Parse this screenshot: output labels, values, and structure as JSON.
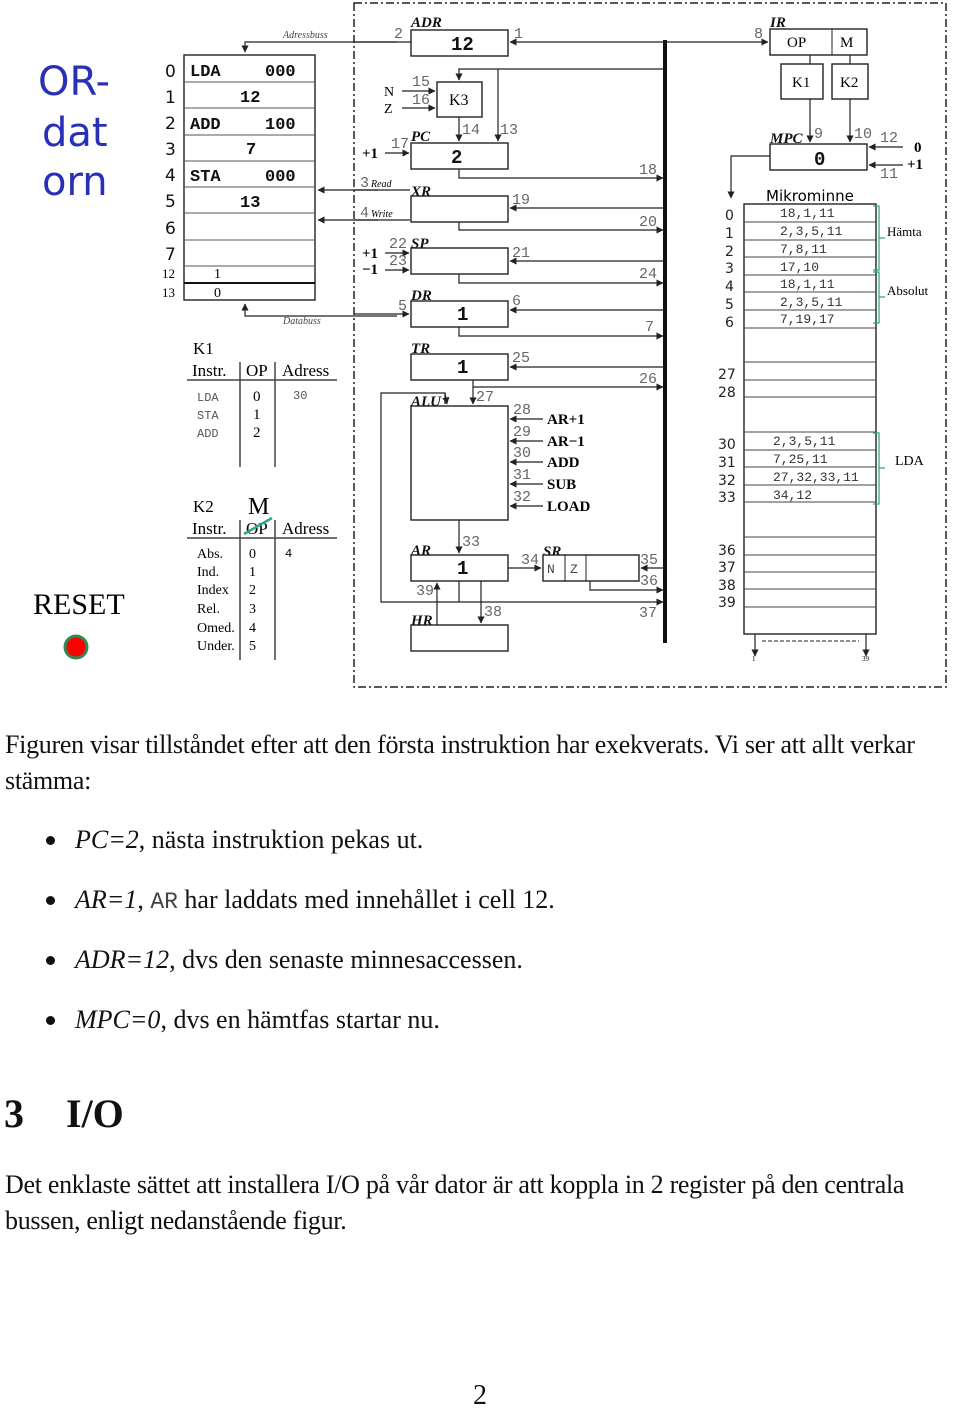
{
  "figure": {
    "title_lines": [
      "OR-",
      "dat",
      "orn"
    ],
    "title_color": "#2a2fb8",
    "reset_label": "RESET",
    "reset_button_color": "#ff0000",
    "reset_button_ring_color": "#2e8b57",
    "memory": {
      "addressbus_label": "Adressbuss",
      "databus_label": "Databuss",
      "rows": [
        {
          "addr": "0",
          "op": "LDA",
          "arg": "000",
          "value": ""
        },
        {
          "addr": "1",
          "op": "",
          "arg": "",
          "value": "12"
        },
        {
          "addr": "2",
          "op": "ADD",
          "arg": "100",
          "value": ""
        },
        {
          "addr": "3",
          "op": "",
          "arg": "",
          "value": "7"
        },
        {
          "addr": "4",
          "op": "STA",
          "arg": "000",
          "value": ""
        },
        {
          "addr": "5",
          "op": "",
          "arg": "",
          "value": "13"
        },
        {
          "addr": "6",
          "op": "",
          "arg": "",
          "value": ""
        },
        {
          "addr": "7",
          "op": "",
          "arg": "",
          "value": ""
        },
        {
          "addr": "12",
          "op": "",
          "arg": "",
          "value": "1"
        },
        {
          "addr": "13",
          "op": "",
          "arg": "",
          "value": "0"
        }
      ]
    },
    "k1_table": {
      "title": "K1",
      "headers": [
        "Instr.",
        "OP",
        "Adress"
      ],
      "rows": [
        {
          "instr": "LDA",
          "op": "0",
          "adress": "30"
        },
        {
          "instr": "STA",
          "op": "1",
          "adress": ""
        },
        {
          "instr": "ADD",
          "op": "2",
          "adress": ""
        }
      ]
    },
    "k2_table": {
      "title": "K2",
      "overwrite_label": "M",
      "headers": [
        "Instr.",
        "OP",
        "Adress"
      ],
      "rows": [
        {
          "instr": "Abs.",
          "op": "0",
          "adress": "4"
        },
        {
          "instr": "Ind.",
          "op": "1",
          "adress": ""
        },
        {
          "instr": "Index",
          "op": "2",
          "adress": ""
        },
        {
          "instr": "Rel.",
          "op": "3",
          "adress": ""
        },
        {
          "instr": "Omed.",
          "op": "4",
          "adress": ""
        },
        {
          "instr": "Under.",
          "op": "5",
          "adress": ""
        }
      ]
    },
    "registers": {
      "adr": {
        "label": "ADR",
        "value": "12",
        "in_signal": "1",
        "out_signal": "2"
      },
      "k3": {
        "label": "K3",
        "n_label": "N",
        "z_label": "Z",
        "n_signal": "15",
        "z_signal": "16",
        "out_signal": "14",
        "bypass_signal": "13"
      },
      "pc": {
        "label": "PC",
        "value": "2",
        "inc_label": "+1",
        "inc_signal": "17",
        "out_signal": "18"
      },
      "read": {
        "signal": "3",
        "label": "Read"
      },
      "write": {
        "signal": "4",
        "label": "Write"
      },
      "xr": {
        "label": "XR",
        "value": "",
        "in_signal": "19",
        "out_signal": "20"
      },
      "sp": {
        "label": "SP",
        "value": "",
        "inc_label": "+1",
        "dec_label": "−1",
        "inc_signal": "22",
        "dec_signal": "23",
        "in_signal": "21",
        "out_signal": "24"
      },
      "dr": {
        "label": "DR",
        "value": "1",
        "mem_signal": "5",
        "in_signal": "6",
        "out_signal": "7"
      },
      "tr": {
        "label": "TR",
        "value": "1",
        "in_signal": "25",
        "out_signal": "26"
      },
      "alu": {
        "label": "ALU",
        "in_signal": "27",
        "ops": [
          {
            "signal": "28",
            "label": "AR+1"
          },
          {
            "signal": "29",
            "label": "AR−1"
          },
          {
            "signal": "30",
            "label": "ADD"
          },
          {
            "signal": "31",
            "label": "SUB"
          },
          {
            "signal": "32",
            "label": "LOAD"
          }
        ]
      },
      "ar": {
        "label": "AR",
        "value": "1",
        "in_signal": "33",
        "hr_in_signal": "39",
        "out_signal": "37"
      },
      "sr": {
        "label": "SR",
        "flags": [
          "N",
          "Z"
        ],
        "in_signal": "34",
        "bus_in_signal": "35",
        "out_signal": "36"
      },
      "hr": {
        "label": "HR",
        "value": "",
        "in_signal": "38"
      },
      "ir": {
        "label": "IR",
        "fields": [
          "OP",
          "M"
        ],
        "in_signal": "8"
      },
      "k1": {
        "label": "K1",
        "signal": "9"
      },
      "k2": {
        "label": "K2",
        "signal": "10"
      },
      "mpc": {
        "label": "MPC",
        "value": "0",
        "reset_label": "0",
        "reset_signal": "12",
        "inc_label": "+1",
        "inc_signal": "11"
      }
    },
    "microprogram": {
      "title": "Mikrominne",
      "rows": [
        {
          "addr": "0",
          "signals": "18,1,11"
        },
        {
          "addr": "1",
          "signals": "2,3,5,11"
        },
        {
          "addr": "2",
          "signals": "7,8,11"
        },
        {
          "addr": "3",
          "signals": "17,10"
        },
        {
          "addr": "4",
          "signals": "18,1,11"
        },
        {
          "addr": "5",
          "signals": "2,3,5,11"
        },
        {
          "addr": "6",
          "signals": "7,19,17"
        },
        {
          "addr": "27",
          "signals": ""
        },
        {
          "addr": "28",
          "signals": ""
        },
        {
          "addr": "30",
          "signals": "2,3,5,11"
        },
        {
          "addr": "31",
          "signals": "7,25,11"
        },
        {
          "addr": "32",
          "signals": "27,32,33,11"
        },
        {
          "addr": "33",
          "signals": "34,12"
        },
        {
          "addr": "36",
          "signals": ""
        },
        {
          "addr": "37",
          "signals": ""
        },
        {
          "addr": "38",
          "signals": ""
        },
        {
          "addr": "39",
          "signals": ""
        }
      ],
      "groups": [
        {
          "label": "Hämta"
        },
        {
          "label": "Absolut"
        },
        {
          "label": "LDA"
        }
      ],
      "output_first": "1",
      "output_last": "39",
      "brace_color": "#2fa88a"
    }
  },
  "text": {
    "para1": "Figuren visar tillståndet efter att den första instruktion har exekverats. Vi ser att allt verkar stämma:",
    "bullets": [
      {
        "lead": "PC=2",
        "rest": ", nästa instruktion pekas ut.",
        "code": "",
        "tail": ""
      },
      {
        "lead": "AR=1",
        "rest": ", ",
        "code": "AR",
        "tail": " har laddats med innehållet i cell 12."
      },
      {
        "lead": "ADR=12",
        "rest": ", dvs den senaste minnesaccessen.",
        "code": "",
        "tail": ""
      },
      {
        "lead": "MPC=0",
        "rest": ", dvs en hämtfas startar nu.",
        "code": "",
        "tail": ""
      }
    ],
    "section_number": "3",
    "section_title": "I/O",
    "para2": "Det enklaste sättet att installera I/O på vår dator är att koppla in 2 register på den centrala bussen, enligt nedanstående figur.",
    "page_number": "2"
  }
}
